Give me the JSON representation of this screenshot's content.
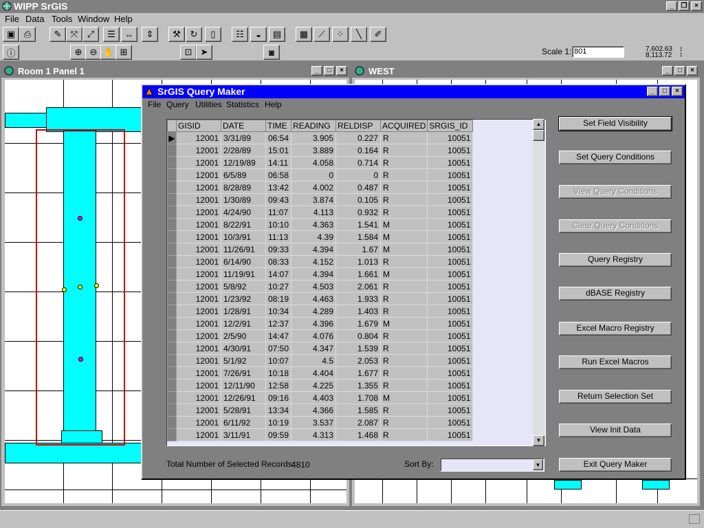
{
  "app": {
    "title": "WIPP SrGIS",
    "menu": [
      "File",
      "Data",
      "Tools",
      "Window",
      "Help"
    ],
    "scale_label": "Scale 1:",
    "scale_value": "801",
    "coord_x": "7,602.63",
    "coord_y": "8,113.72"
  },
  "windows": {
    "left_title": "Room 1 Panel 1",
    "right_title": "WEST"
  },
  "dialog": {
    "title": "SrGIS Query Maker",
    "menu": [
      "File",
      "Query",
      "Utilities",
      "Statistics",
      "Help"
    ],
    "columns": [
      "GISID",
      "DATE",
      "TIME",
      "READING",
      "RELDISP",
      "ACQUIRED",
      "SRGIS_ID"
    ],
    "rows": [
      [
        "12001",
        "3/31/89",
        "06:54",
        "3.905",
        "0.227",
        "R",
        "10051"
      ],
      [
        "12001",
        "2/28/89",
        "15:01",
        "3.889",
        "0.164",
        "R",
        "10051"
      ],
      [
        "12001",
        "12/19/89",
        "14:11",
        "4.058",
        "0.714",
        "R",
        "10051"
      ],
      [
        "12001",
        "6/5/89",
        "06:58",
        "0",
        "0",
        "R",
        "10051"
      ],
      [
        "12001",
        "8/28/89",
        "13:42",
        "4.002",
        "0.487",
        "R",
        "10051"
      ],
      [
        "12001",
        "1/30/89",
        "09:43",
        "3.874",
        "0.105",
        "R",
        "10051"
      ],
      [
        "12001",
        "4/24/90",
        "11:07",
        "4.113",
        "0.932",
        "R",
        "10051"
      ],
      [
        "12001",
        "8/22/91",
        "10:10",
        "4.363",
        "1.541",
        "M",
        "10051"
      ],
      [
        "12001",
        "10/3/91",
        "11:13",
        "4.39",
        "1.584",
        "M",
        "10051"
      ],
      [
        "12001",
        "11/26/91",
        "09:33",
        "4.394",
        "1.67",
        "M",
        "10051"
      ],
      [
        "12001",
        "6/14/90",
        "08:33",
        "4.152",
        "1.013",
        "R",
        "10051"
      ],
      [
        "12001",
        "11/19/91",
        "14:07",
        "4.394",
        "1.661",
        "M",
        "10051"
      ],
      [
        "12001",
        "5/8/92",
        "10:27",
        "4.503",
        "2.061",
        "R",
        "10051"
      ],
      [
        "12001",
        "1/23/92",
        "08:19",
        "4.463",
        "1.933",
        "R",
        "10051"
      ],
      [
        "12001",
        "1/28/91",
        "10:34",
        "4.289",
        "1.403",
        "R",
        "10051"
      ],
      [
        "12001",
        "12/2/91",
        "12:37",
        "4.396",
        "1.679",
        "M",
        "10051"
      ],
      [
        "12001",
        "2/5/90",
        "14:47",
        "4.076",
        "0.804",
        "R",
        "10051"
      ],
      [
        "12001",
        "4/30/91",
        "07:50",
        "4.347",
        "1.539",
        "R",
        "10051"
      ],
      [
        "12001",
        "5/1/92",
        "10:07",
        "4.5",
        "2.053",
        "R",
        "10051"
      ],
      [
        "12001",
        "7/26/91",
        "10:18",
        "4.404",
        "1.677",
        "R",
        "10051"
      ],
      [
        "12001",
        "12/11/90",
        "12:58",
        "4.225",
        "1.355",
        "R",
        "10051"
      ],
      [
        "12001",
        "12/26/91",
        "09:16",
        "4.403",
        "1.708",
        "M",
        "10051"
      ],
      [
        "12001",
        "5/28/91",
        "13:34",
        "4.366",
        "1.585",
        "R",
        "10051"
      ],
      [
        "12001",
        "6/11/92",
        "10:19",
        "3.537",
        "2.087",
        "R",
        "10051"
      ],
      [
        "12001",
        "3/11/91",
        "09:59",
        "4.313",
        "1.468",
        "R",
        "10051"
      ]
    ],
    "total_label": "Total Number of Selected Records:",
    "total_value": "4810",
    "sort_label": "Sort By:",
    "sort_value": "",
    "buttons": [
      {
        "label": "Set Field Visibility",
        "enabled": true
      },
      {
        "label": "Set Query Conditions",
        "enabled": true
      },
      {
        "label": "View Query Conditions",
        "enabled": false
      },
      {
        "label": "Clear Query Conditions",
        "enabled": false
      },
      {
        "label": "Query Registry",
        "enabled": true
      },
      {
        "label": "dBASE Registry",
        "enabled": true
      },
      {
        "label": "Excel Macro Registry",
        "enabled": true
      },
      {
        "label": "Run Excel Macros",
        "enabled": true
      },
      {
        "label": "Return Selection Set",
        "enabled": true
      },
      {
        "label": "View Init Data",
        "enabled": true
      },
      {
        "label": "Exit Query Maker",
        "enabled": true
      }
    ]
  },
  "colors": {
    "title_active": "#0000ff",
    "title_inactive": "#808080",
    "map_fill": "#00ffff",
    "outline": "#cc0000"
  }
}
